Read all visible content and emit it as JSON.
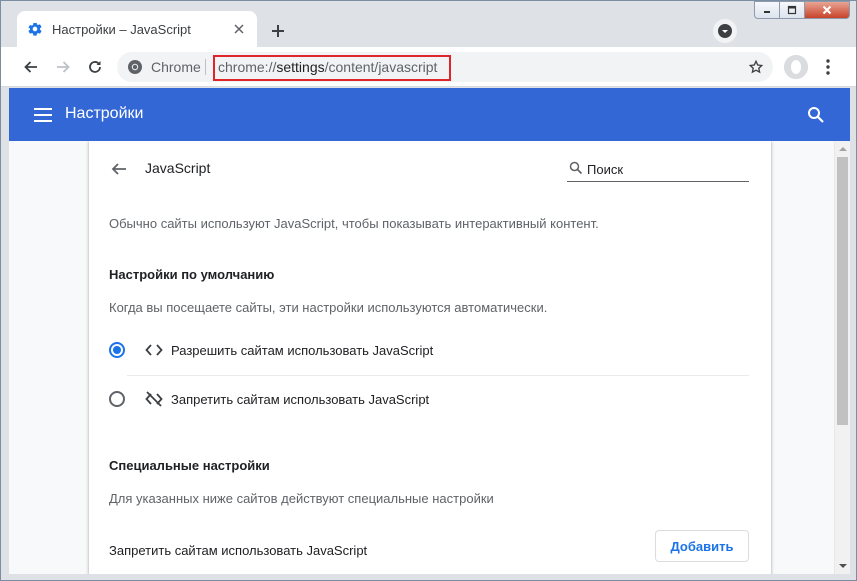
{
  "tab": {
    "title": "Настройки – JavaScript",
    "icon": "gear-icon"
  },
  "toolbar": {
    "site_label": "Chrome",
    "url_scheme": "chrome://",
    "url_host": "settings",
    "url_path": "/content/javascript"
  },
  "header": {
    "title": "Настройки"
  },
  "subpage": {
    "title": "JavaScript",
    "search_placeholder": "Поиск",
    "description": "Обычно сайты используют JavaScript, чтобы показывать интерактивный контент.",
    "default_heading": "Настройки по умолчанию",
    "default_description": "Когда вы посещаете сайты, эти настройки используются автоматически.",
    "options": [
      {
        "label": "Разрешить сайтам использовать JavaScript",
        "checked": true,
        "icon": "code-icon"
      },
      {
        "label": "Запретить сайтам использовать JavaScript",
        "checked": false,
        "icon": "code-off-icon"
      }
    ],
    "custom_heading": "Специальные настройки",
    "custom_description": "Для указанных ниже сайтов действуют специальные настройки",
    "block_label": "Запретить сайтам использовать JavaScript",
    "add_button": "Добавить"
  },
  "colors": {
    "header": "#3367d6",
    "accent": "#1a73e8",
    "url_highlight": "#e0252a"
  }
}
